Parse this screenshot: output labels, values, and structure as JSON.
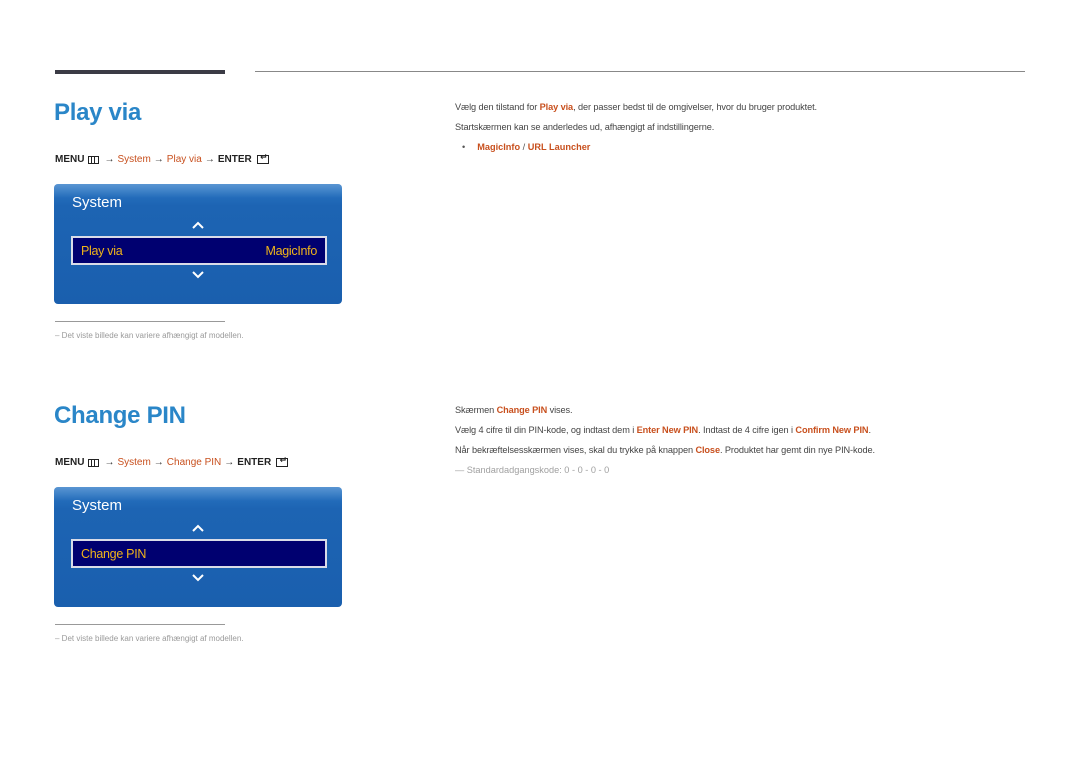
{
  "sections": [
    {
      "title": "Play via",
      "menu_path": {
        "menu_label": "MENU",
        "arrow": "→",
        "steps": [
          "System",
          "Play via"
        ],
        "enter_label": "ENTER"
      },
      "osd": {
        "title": "System",
        "item_label": "Play via",
        "item_value": "MagicInfo"
      },
      "footnote": "–   Det viste billede kan variere afhængigt af modellen.",
      "description": {
        "line1_pre": "Vælg den tilstand for ",
        "line1_hl": "Play via",
        "line1_post": ", der passer bedst til de omgivelser, hvor du bruger produktet.",
        "line2": "Startskærmen kan se anderledes ud, afhængigt af indstillingerne.",
        "bullet": "•",
        "options": [
          "MagicInfo",
          "URL Launcher"
        ],
        "options_separator": " / "
      }
    },
    {
      "title": "Change PIN",
      "menu_path": {
        "menu_label": "MENU",
        "arrow": "→",
        "steps": [
          "System",
          "Change PIN"
        ],
        "enter_label": "ENTER"
      },
      "osd": {
        "title": "System",
        "item_label": "Change PIN",
        "item_value": ""
      },
      "footnote": "–   Det viste billede kan variere afhængigt af modellen.",
      "description": {
        "line1_pre": "Skærmen ",
        "line1_hl": "Change PIN",
        "line1_post": " vises.",
        "line2_pre": "Vælg 4 cifre til din PIN-kode, og indtast dem i ",
        "line2_hl1": "Enter New PIN",
        "line2_mid": ". Indtast de 4 cifre igen i ",
        "line2_hl2": "Confirm New PIN",
        "line2_post": ".",
        "line3_pre": "Når bekræftelsesskærmen vises, skal du trykke på knappen ",
        "line3_hl": "Close",
        "line3_post": ". Produktet har gemt din nye PIN-kode.",
        "note": "—  Standardadgangskode: 0 - 0 - 0 - 0"
      }
    }
  ],
  "colors": {
    "title_blue": "#2a86c8",
    "highlight_orange": "#c8501e",
    "osd_blue": "#1a5fae",
    "osd_item_bg": "#000070",
    "osd_item_text": "#f0b41a"
  }
}
